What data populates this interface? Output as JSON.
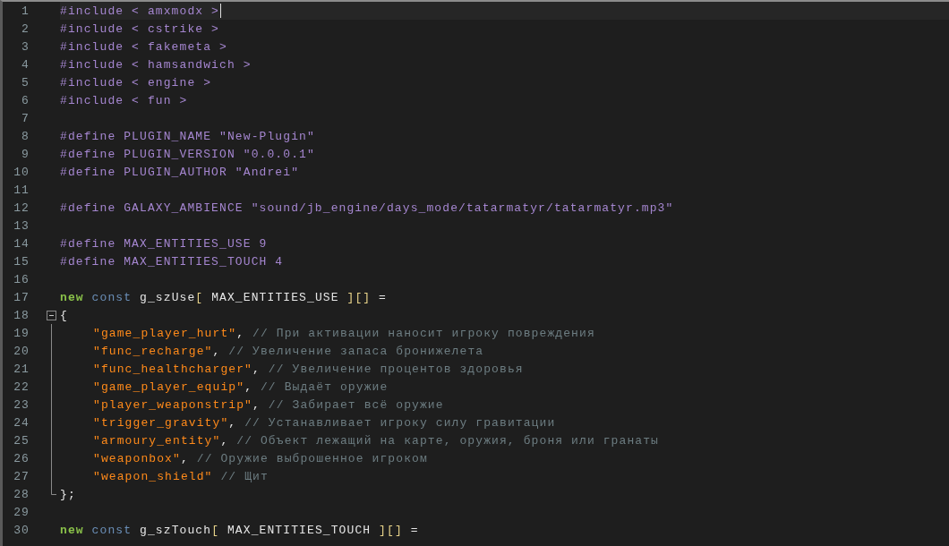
{
  "editor": {
    "lines": [
      {
        "number": "1",
        "current": true,
        "tokens": [
          {
            "kind": "preproc",
            "text": "#include < amxmodx >"
          }
        ]
      },
      {
        "number": "2",
        "current": false,
        "tokens": [
          {
            "kind": "preproc",
            "text": "#include < cstrike >"
          }
        ]
      },
      {
        "number": "3",
        "current": false,
        "tokens": [
          {
            "kind": "preproc",
            "text": "#include < fakemeta >"
          }
        ]
      },
      {
        "number": "4",
        "current": false,
        "tokens": [
          {
            "kind": "preproc",
            "text": "#include < hamsandwich >"
          }
        ]
      },
      {
        "number": "5",
        "current": false,
        "tokens": [
          {
            "kind": "preproc",
            "text": "#include < engine >"
          }
        ]
      },
      {
        "number": "6",
        "current": false,
        "tokens": [
          {
            "kind": "preproc",
            "text": "#include < fun >"
          }
        ]
      },
      {
        "number": "7",
        "current": false
      },
      {
        "number": "8",
        "current": false,
        "tokens": [
          {
            "kind": "preproc",
            "text": "#define PLUGIN_NAME \"New-Plugin\""
          }
        ]
      },
      {
        "number": "9",
        "current": false,
        "tokens": [
          {
            "kind": "preproc",
            "text": "#define PLUGIN_VERSION \"0.0.0.1\""
          }
        ]
      },
      {
        "number": "10",
        "current": false,
        "tokens": [
          {
            "kind": "preproc",
            "text": "#define PLUGIN_AUTHOR \"Andrei\""
          }
        ]
      },
      {
        "number": "11",
        "current": false
      },
      {
        "number": "12",
        "current": false,
        "tokens": [
          {
            "kind": "preproc",
            "text": "#define GALAXY_AMBIENCE \"sound/jb_engine/days_mode/tatarmatyr/tatarmatyr.mp3\""
          }
        ]
      },
      {
        "number": "13",
        "current": false
      },
      {
        "number": "14",
        "current": false,
        "tokens": [
          {
            "kind": "preproc",
            "text": "#define MAX_ENTITIES_USE 9"
          }
        ]
      },
      {
        "number": "15",
        "current": false,
        "tokens": [
          {
            "kind": "preproc",
            "text": "#define MAX_ENTITIES_TOUCH 4"
          }
        ]
      },
      {
        "number": "16",
        "current": false
      },
      {
        "number": "17",
        "current": false,
        "tokens": [
          {
            "kind": "keyword",
            "text": "new"
          },
          {
            "kind": "type",
            "text": " const"
          },
          {
            "kind": "ident",
            "text": " g_szUse"
          },
          {
            "kind": "bracket",
            "text": "["
          },
          {
            "kind": "ident",
            "text": " MAX_ENTITIES_USE "
          },
          {
            "kind": "bracket",
            "text": "][]"
          },
          {
            "kind": "ident",
            "text": " ="
          }
        ]
      },
      {
        "number": "18",
        "current": false,
        "fold_start": true,
        "tokens": [
          {
            "kind": "punct",
            "text": "{"
          }
        ]
      },
      {
        "number": "19",
        "current": false,
        "in_fold": true,
        "indent": true,
        "tokens": [
          {
            "kind": "string",
            "text": "\"game_player_hurt\""
          },
          {
            "kind": "punct",
            "text": ","
          },
          {
            "kind": "comment",
            "text": " // При активации наносит игроку повреждения"
          }
        ]
      },
      {
        "number": "20",
        "current": false,
        "in_fold": true,
        "indent": true,
        "tokens": [
          {
            "kind": "string",
            "text": "\"func_recharge\""
          },
          {
            "kind": "punct",
            "text": ","
          },
          {
            "kind": "comment",
            "text": " // Увеличение запаса бронижелета"
          }
        ]
      },
      {
        "number": "21",
        "current": false,
        "in_fold": true,
        "indent": true,
        "tokens": [
          {
            "kind": "string",
            "text": "\"func_healthcharger\""
          },
          {
            "kind": "punct",
            "text": ","
          },
          {
            "kind": "comment",
            "text": " // Увеличение процентов здоровья"
          }
        ]
      },
      {
        "number": "22",
        "current": false,
        "in_fold": true,
        "indent": true,
        "tokens": [
          {
            "kind": "string",
            "text": "\"game_player_equip\""
          },
          {
            "kind": "punct",
            "text": ","
          },
          {
            "kind": "comment",
            "text": " // Выдаёт оружие"
          }
        ]
      },
      {
        "number": "23",
        "current": false,
        "in_fold": true,
        "indent": true,
        "tokens": [
          {
            "kind": "string",
            "text": "\"player_weaponstrip\""
          },
          {
            "kind": "punct",
            "text": ","
          },
          {
            "kind": "comment",
            "text": " // Забирает всё оружие"
          }
        ]
      },
      {
        "number": "24",
        "current": false,
        "in_fold": true,
        "indent": true,
        "tokens": [
          {
            "kind": "string",
            "text": "\"trigger_gravity\""
          },
          {
            "kind": "punct",
            "text": ","
          },
          {
            "kind": "comment",
            "text": " // Устанавливает игроку силу гравитации"
          }
        ]
      },
      {
        "number": "25",
        "current": false,
        "in_fold": true,
        "indent": true,
        "tokens": [
          {
            "kind": "string",
            "text": "\"armoury_entity\""
          },
          {
            "kind": "punct",
            "text": ","
          },
          {
            "kind": "comment",
            "text": " // Объект лежащий на карте, оружия, броня или гранаты"
          }
        ]
      },
      {
        "number": "26",
        "current": false,
        "in_fold": true,
        "indent": true,
        "tokens": [
          {
            "kind": "string",
            "text": "\"weaponbox\""
          },
          {
            "kind": "punct",
            "text": ","
          },
          {
            "kind": "comment",
            "text": " // Оружие выброшенное игроком"
          }
        ]
      },
      {
        "number": "27",
        "current": false,
        "in_fold": true,
        "indent": true,
        "tokens": [
          {
            "kind": "string",
            "text": "\"weapon_shield\""
          },
          {
            "kind": "comment",
            "text": " // Щит"
          }
        ]
      },
      {
        "number": "28",
        "current": false,
        "fold_end": true,
        "tokens": [
          {
            "kind": "punct",
            "text": "};"
          }
        ]
      },
      {
        "number": "29",
        "current": false
      },
      {
        "number": "30",
        "current": false,
        "tokens": [
          {
            "kind": "keyword",
            "text": "new"
          },
          {
            "kind": "type",
            "text": " const"
          },
          {
            "kind": "ident",
            "text": " g_szTouch"
          },
          {
            "kind": "bracket",
            "text": "["
          },
          {
            "kind": "ident",
            "text": " MAX_ENTITIES_TOUCH "
          },
          {
            "kind": "bracket",
            "text": "][]"
          },
          {
            "kind": "ident",
            "text": " ="
          }
        ]
      }
    ]
  }
}
